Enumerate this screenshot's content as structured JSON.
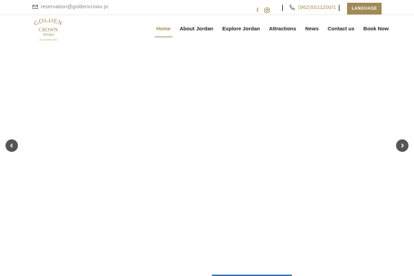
{
  "topbar": {
    "email": "reservation@goldencrown.jo",
    "phone": "(962)5511200/1",
    "language_button": "LANGUAGE",
    "social": [
      {
        "icon": "facebook-icon",
        "glyph": "f"
      },
      {
        "icon": "instagram-icon"
      }
    ]
  },
  "logo": {
    "line1": "GOLDEN",
    "line2": "CROWN",
    "line3": "TOURS",
    "tagline": "DISCOVER AMMAN JORDAN"
  },
  "nav": {
    "items": [
      {
        "label": "Home",
        "active": true
      },
      {
        "label": "About Jordan"
      },
      {
        "label": "Explore Jordan"
      },
      {
        "label": "Attractions"
      },
      {
        "label": "News"
      },
      {
        "label": "Contact us"
      },
      {
        "label": "Book Now"
      }
    ]
  },
  "colors": {
    "accent": "#a08a56",
    "arrow_bg": "#555555",
    "strip": "#2e73b8"
  },
  "slider": {
    "prev_icon": "chevron-left-icon",
    "next_icon": "chevron-right-icon"
  }
}
